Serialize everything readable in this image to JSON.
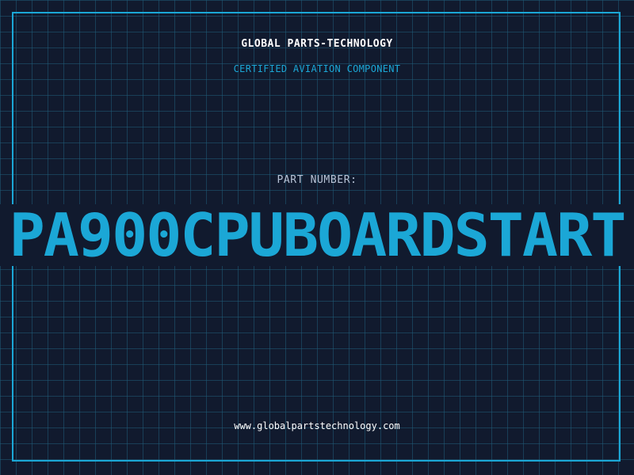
{
  "header": {
    "brand": "GLOBAL PARTS-TECHNOLOGY",
    "subtitle": "CERTIFIED AVIATION COMPONENT"
  },
  "part": {
    "label": "PART NUMBER:",
    "number": "PA900CPUBOARDSTART"
  },
  "footer": {
    "website": "www.globalpartstechnology.com"
  },
  "colors": {
    "background": "#111a2e",
    "grid": "#1f5c78",
    "accent": "#1ba7d6",
    "text": "#ffffff",
    "muted_text": "#b7c3d6"
  }
}
